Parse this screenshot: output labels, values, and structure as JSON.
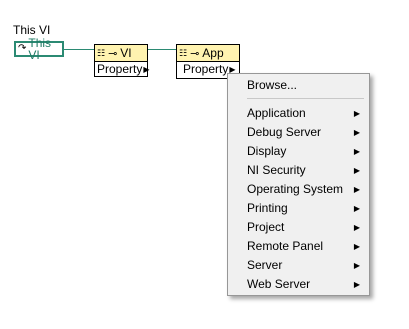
{
  "diagram": {
    "label": "This VI",
    "this_vi_text": "This VI",
    "vi_node": {
      "class": "VI",
      "property": "Property"
    },
    "app_node": {
      "class": "App",
      "property": "Property"
    }
  },
  "menu": {
    "browse": "Browse...",
    "items": [
      "Application",
      "Debug Server",
      "Display",
      "NI Security",
      "Operating System",
      "Printing",
      "Project",
      "Remote Panel",
      "Server",
      "Web Server"
    ]
  }
}
